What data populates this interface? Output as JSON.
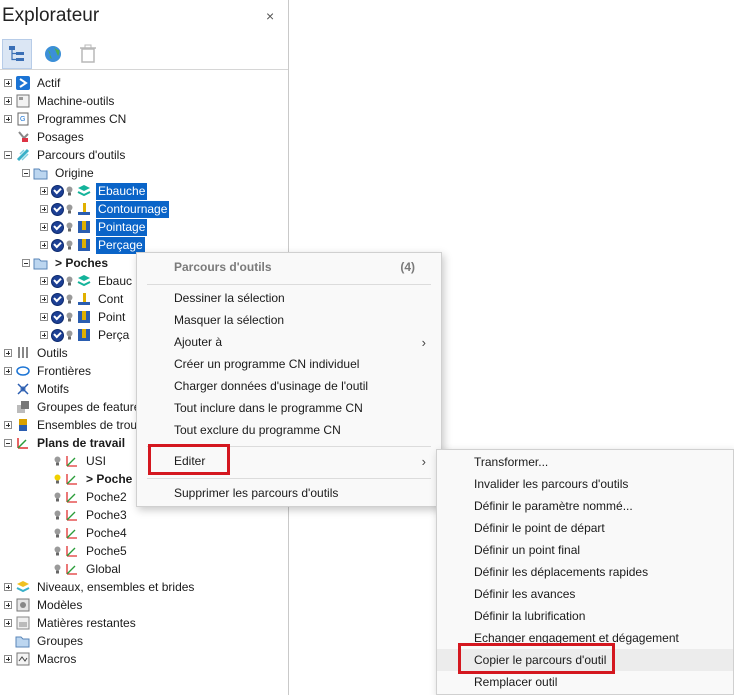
{
  "explorer": {
    "title": "Explorateur",
    "close_label": "×",
    "toolbar": [
      "tree-view-icon",
      "globe-icon",
      "trash-icon"
    ]
  },
  "tree": {
    "actif": "Actif",
    "machine_outils": "Machine-outils",
    "programmes_cn": "Programmes CN",
    "posages": "Posages",
    "parcours_outils": "Parcours d'outils",
    "origine": "Origine",
    "origine_items": [
      "Ebauche",
      "Contournage",
      "Pointage",
      "Perçage"
    ],
    "poches": "> Poches",
    "poches_items": [
      "Ebauc",
      "Cont",
      "Point",
      "Perça"
    ],
    "outils": "Outils",
    "frontieres": "Frontières",
    "motifs": "Motifs",
    "groupes_features": "Groupes de feature",
    "ensembles_trous": "Ensembles de trou",
    "plans_travail": "Plans de travail",
    "plans_items": [
      "USI",
      "> Poche",
      "Poche2",
      "Poche3",
      "Poche4",
      "Poche5",
      "Global"
    ],
    "niveaux": "Niveaux, ensembles et brides",
    "modeles": "Modèles",
    "matieres": "Matières restantes",
    "groupes": "Groupes",
    "macros": "Macros"
  },
  "context_menu": {
    "header": "Parcours d'outils",
    "count": "(4)",
    "items": [
      "Dessiner la sélection",
      "Masquer la sélection",
      "Ajouter à",
      "Créer un programme CN individuel",
      "Charger données d'usinage de l'outil",
      "Tout inclure dans le programme CN",
      "Tout exclure du programme CN"
    ],
    "editer": "Editer",
    "supprimer": "Supprimer les parcours d'outils",
    "arrow": "›"
  },
  "submenu": {
    "items": [
      "Transformer...",
      "Invalider les parcours d'outils",
      "Définir le paramètre nommé...",
      "Définir le point de départ",
      "Définir un point final",
      "Définir les déplacements rapides",
      "Définir les avances",
      "Définir la lubrification",
      "Echanger engagement et dégagement",
      "Copier le parcours d'outil",
      "Remplacer outil"
    ]
  },
  "colors": {
    "selection": "#0a64c8",
    "highlight_box": "#d4171f"
  }
}
